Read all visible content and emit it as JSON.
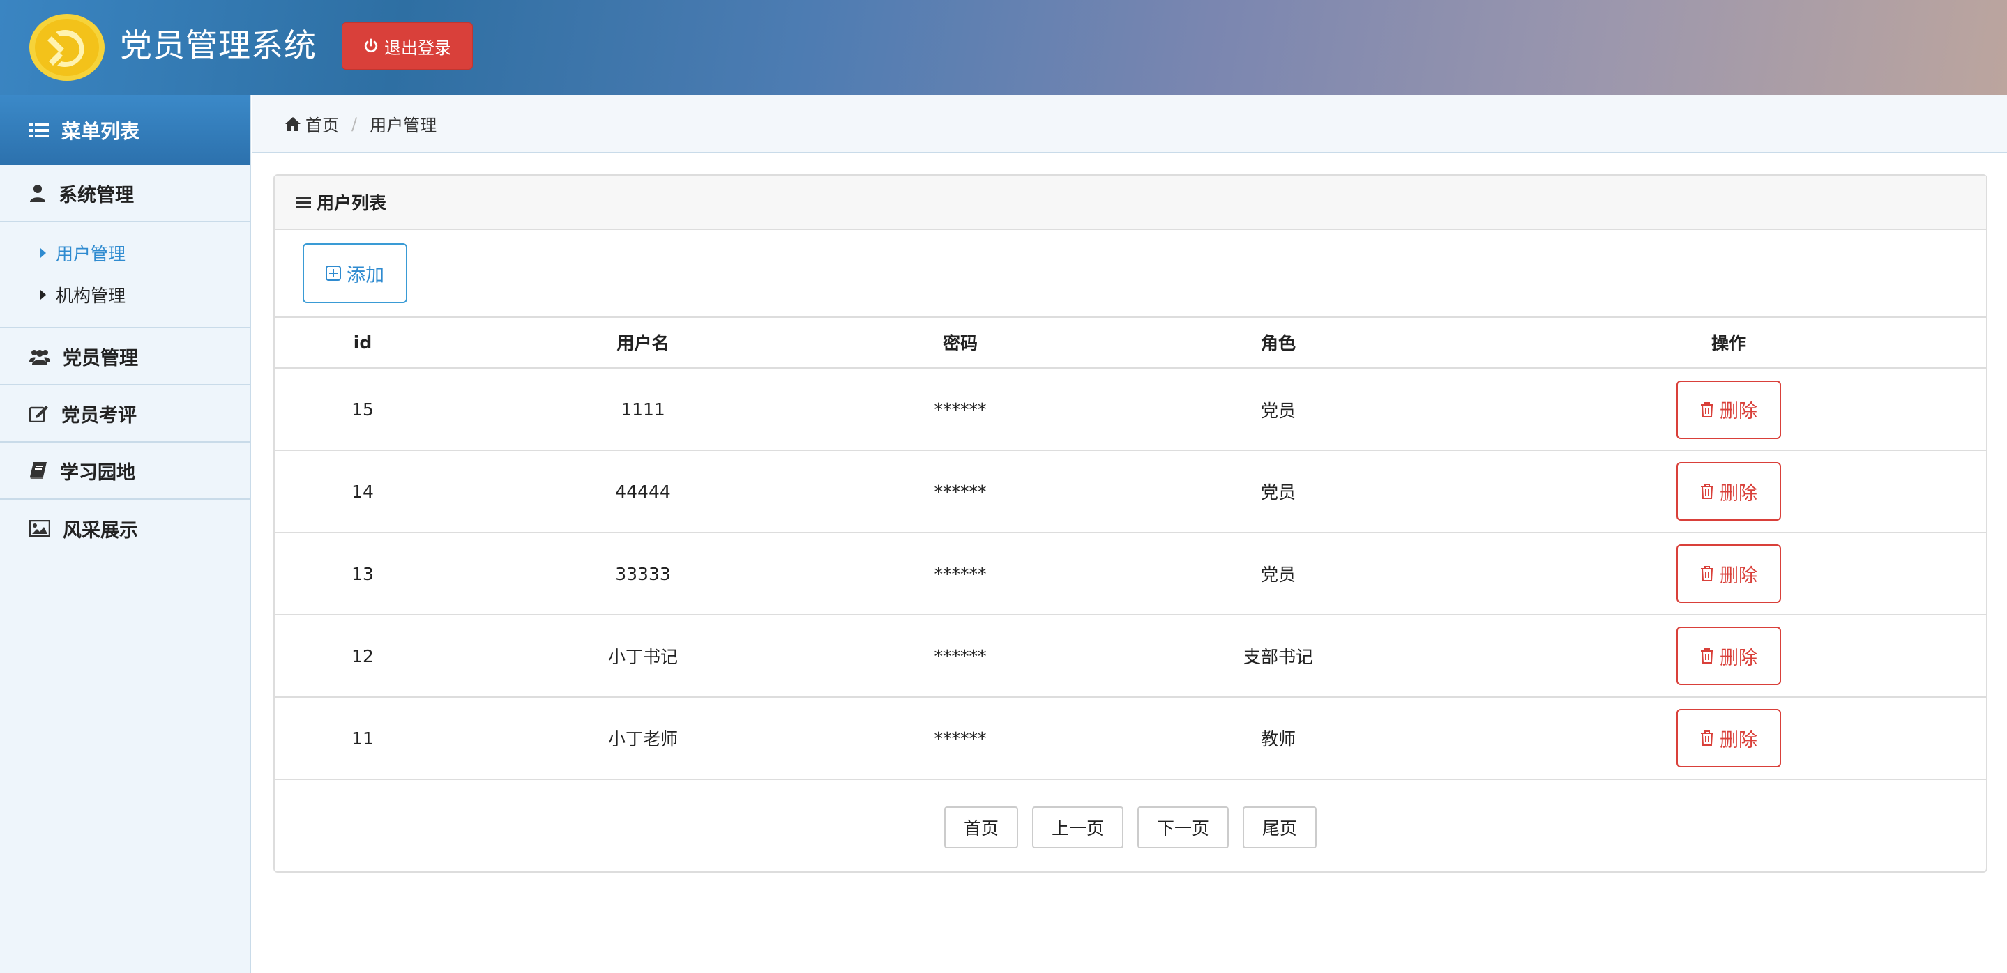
{
  "header": {
    "title": "党员管理系统",
    "logout_label": "退出登录",
    "colors": {
      "logout": "#d9403a",
      "logo_bg": "#f6d33a",
      "logo_emblem": "#e8b20e"
    }
  },
  "sidebar": {
    "heading": "菜单列表",
    "groups": [
      {
        "label": "系统管理",
        "icon": "user-icon"
      },
      {
        "label": "党员管理",
        "icon": "users-icon"
      },
      {
        "label": "党员考评",
        "icon": "edit-icon"
      },
      {
        "label": "学习园地",
        "icon": "book-icon"
      },
      {
        "label": "风采展示",
        "icon": "image-icon"
      }
    ],
    "submenu": [
      {
        "label": "用户管理",
        "active": true
      },
      {
        "label": "机构管理",
        "active": false
      }
    ]
  },
  "breadcrumb": {
    "home": "首页",
    "separator": "/",
    "current": "用户管理"
  },
  "panel": {
    "title": "用户列表",
    "add_label": "添加"
  },
  "table": {
    "headers": [
      "id",
      "用户名",
      "密码",
      "角色",
      "操作"
    ],
    "rows": [
      {
        "id": "15",
        "username": "1111",
        "password": "******",
        "role": "党员",
        "action": "删除"
      },
      {
        "id": "14",
        "username": "44444",
        "password": "******",
        "role": "党员",
        "action": "删除"
      },
      {
        "id": "13",
        "username": "33333",
        "password": "******",
        "role": "党员",
        "action": "删除"
      },
      {
        "id": "12",
        "username": "小丁书记",
        "password": "******",
        "role": "支部书记",
        "action": "删除"
      },
      {
        "id": "11",
        "username": "小丁老师",
        "password": "******",
        "role": "教师",
        "action": "删除"
      }
    ]
  },
  "pager": {
    "first": "首页",
    "prev": "上一页",
    "next": "下一页",
    "last": "尾页"
  }
}
